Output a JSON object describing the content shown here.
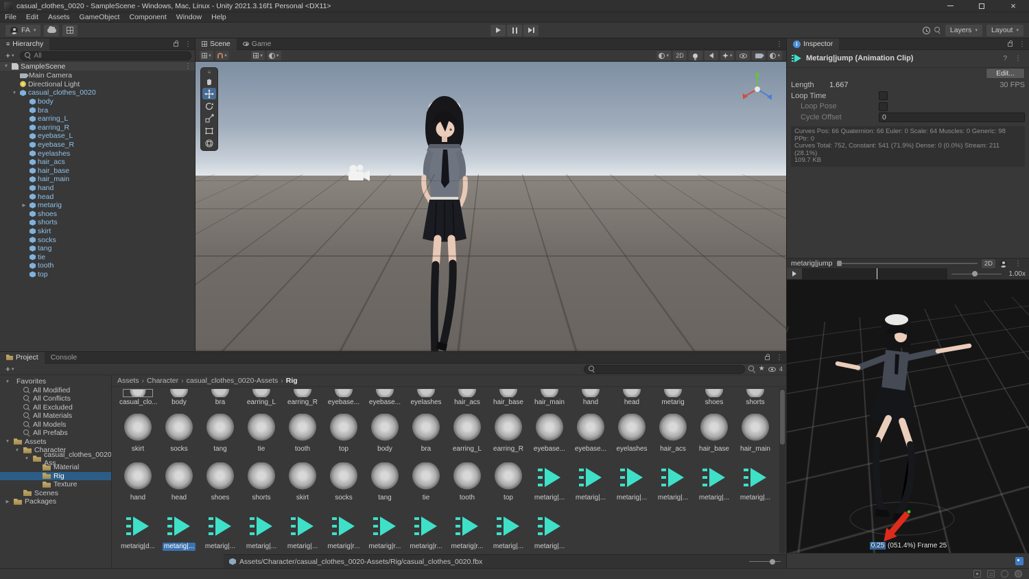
{
  "window": {
    "title": "casual_clothes_0020 - SampleScene - Windows, Mac, Linux - Unity 2021.3.16f1 Personal <DX11>"
  },
  "menu": [
    "File",
    "Edit",
    "Assets",
    "GameObject",
    "Component",
    "Window",
    "Help"
  ],
  "toolbar": {
    "account": "FA",
    "layers": "Layers",
    "layout": "Layout"
  },
  "hierarchy": {
    "tab": "Hierarchy",
    "search": "All",
    "scene_name": "SampleScene",
    "items": [
      {
        "label": "Main Camera",
        "d": 1,
        "icon": "camera"
      },
      {
        "label": "Directional Light",
        "d": 1,
        "icon": "light"
      },
      {
        "label": "casual_clothes_0020",
        "d": 1,
        "icon": "prefab",
        "kind": "prefab",
        "arrow": "▼"
      },
      {
        "label": "body",
        "d": 2,
        "icon": "prefab",
        "kind": "prefab"
      },
      {
        "label": "bra",
        "d": 2,
        "icon": "prefab",
        "kind": "prefab"
      },
      {
        "label": "earring_L",
        "d": 2,
        "icon": "prefab",
        "kind": "prefab"
      },
      {
        "label": "earring_R",
        "d": 2,
        "icon": "prefab",
        "kind": "prefab"
      },
      {
        "label": "eyebase_L",
        "d": 2,
        "icon": "prefab",
        "kind": "prefab"
      },
      {
        "label": "eyebase_R",
        "d": 2,
        "icon": "prefab",
        "kind": "prefab"
      },
      {
        "label": "eyelashes",
        "d": 2,
        "icon": "prefab",
        "kind": "prefab"
      },
      {
        "label": "hair_acs",
        "d": 2,
        "icon": "prefab",
        "kind": "prefab"
      },
      {
        "label": "hair_base",
        "d": 2,
        "icon": "prefab",
        "kind": "prefab"
      },
      {
        "label": "hair_main",
        "d": 2,
        "icon": "prefab",
        "kind": "prefab"
      },
      {
        "label": "hand",
        "d": 2,
        "icon": "prefab",
        "kind": "prefab"
      },
      {
        "label": "head",
        "d": 2,
        "icon": "prefab",
        "kind": "prefab"
      },
      {
        "label": "metarig",
        "d": 2,
        "icon": "prefab",
        "kind": "prefab",
        "arrow": "▶"
      },
      {
        "label": "shoes",
        "d": 2,
        "icon": "prefab",
        "kind": "prefab"
      },
      {
        "label": "shorts",
        "d": 2,
        "icon": "prefab",
        "kind": "prefab"
      },
      {
        "label": "skirt",
        "d": 2,
        "icon": "prefab",
        "kind": "prefab"
      },
      {
        "label": "socks",
        "d": 2,
        "icon": "prefab",
        "kind": "prefab"
      },
      {
        "label": "tang",
        "d": 2,
        "icon": "prefab",
        "kind": "prefab"
      },
      {
        "label": "tie",
        "d": 2,
        "icon": "prefab",
        "kind": "prefab"
      },
      {
        "label": "tooth",
        "d": 2,
        "icon": "prefab",
        "kind": "prefab"
      },
      {
        "label": "top",
        "d": 2,
        "icon": "prefab",
        "kind": "prefab"
      }
    ]
  },
  "scene": {
    "tab_scene": "Scene",
    "tab_game": "Game",
    "mode2d": "2D"
  },
  "inspector": {
    "tab": "Inspector",
    "title": "Metarig|jump (Animation Clip)",
    "edit": "Edit...",
    "length_label": "Length",
    "length_value": "1.667",
    "fps": "30 FPS",
    "loop_time": "Loop Time",
    "loop_pose": "Loop Pose",
    "cycle_offset": "Cycle Offset",
    "cycle_value": "0",
    "stats1": "Curves Pos: 66 Quaternion: 66 Euler: 0 Scale: 64 Muscles: 0 Generic: 98 PPtr: 0",
    "stats2": "Curves Total: 752, Constant: 541 (71.9%) Dense: 0 (0.0%) Stream: 211 (28.1%)",
    "stats3": "109.7 KB",
    "preview": {
      "clip": "metarig|jump",
      "mode2d": "2D",
      "speed": "1.00x",
      "frame_field": "0.25",
      "frame_info": "(051.4%) Frame 25"
    }
  },
  "project": {
    "tab": "Project",
    "console_tab": "Console",
    "hidden_count": "4",
    "breadcrumb": [
      "Assets",
      "Character",
      "casual_clothes_0020-Assets",
      "Rig"
    ],
    "tree": [
      {
        "label": "Favorites",
        "d": 0,
        "icon": "star",
        "arrow": "▼"
      },
      {
        "label": "All Modified",
        "d": 1,
        "icon": "search"
      },
      {
        "label": "All Conflicts",
        "d": 1,
        "icon": "search"
      },
      {
        "label": "All Excluded",
        "d": 1,
        "icon": "search"
      },
      {
        "label": "All Materials",
        "d": 1,
        "icon": "search"
      },
      {
        "label": "All Models",
        "d": 1,
        "icon": "search"
      },
      {
        "label": "All Prefabs",
        "d": 1,
        "icon": "search"
      },
      {
        "label": "Assets",
        "d": 0,
        "icon": "folder",
        "arrow": "▼"
      },
      {
        "label": "Character",
        "d": 1,
        "icon": "folder",
        "arrow": "▼"
      },
      {
        "label": "casual_clothes_0020-Ass...",
        "d": 2,
        "icon": "folder",
        "arrow": "▼"
      },
      {
        "label": "Material",
        "d": 3,
        "icon": "folder"
      },
      {
        "label": "Rig",
        "d": 3,
        "icon": "folder",
        "sel": true
      },
      {
        "label": "Texture",
        "d": 3,
        "icon": "folder"
      },
      {
        "label": "Scenes",
        "d": 1,
        "icon": "folder"
      },
      {
        "label": "Packages",
        "d": 0,
        "icon": "folder",
        "arrow": "▶"
      }
    ],
    "row1": [
      {
        "label": "casual_clo...",
        "thumb": "fbx",
        "outlined": true
      },
      {
        "label": "body",
        "thumb": "mesh"
      },
      {
        "label": "bra",
        "thumb": "mesh"
      },
      {
        "label": "earring_L",
        "thumb": "mesh"
      },
      {
        "label": "earring_R",
        "thumb": "mesh"
      },
      {
        "label": "eyebase...",
        "thumb": "mesh"
      },
      {
        "label": "eyebase...",
        "thumb": "mesh"
      },
      {
        "label": "eyelashes",
        "thumb": "mesh"
      },
      {
        "label": "hair_acs",
        "thumb": "mesh"
      },
      {
        "label": "hair_base",
        "thumb": "mesh"
      },
      {
        "label": "hair_main",
        "thumb": "mesh"
      },
      {
        "label": "hand",
        "thumb": "mesh"
      },
      {
        "label": "head",
        "thumb": "mesh"
      },
      {
        "label": "metarig",
        "thumb": "mesh"
      },
      {
        "label": "shoes",
        "thumb": "mesh"
      },
      {
        "label": "shorts",
        "thumb": "mesh"
      }
    ],
    "row2": [
      {
        "label": "skirt",
        "thumb": "mesh"
      },
      {
        "label": "socks",
        "thumb": "mesh"
      },
      {
        "label": "tang",
        "thumb": "mesh"
      },
      {
        "label": "tie",
        "thumb": "mesh"
      },
      {
        "label": "tooth",
        "thumb": "mesh"
      },
      {
        "label": "top",
        "thumb": "mesh"
      },
      {
        "label": "body",
        "thumb": "mesh"
      },
      {
        "label": "bra",
        "thumb": "mesh"
      },
      {
        "label": "earring_L",
        "thumb": "mesh"
      },
      {
        "label": "earring_R",
        "thumb": "mesh"
      },
      {
        "label": "eyebase...",
        "thumb": "mesh"
      },
      {
        "label": "eyebase...",
        "thumb": "mesh"
      },
      {
        "label": "eyelashes",
        "thumb": "mesh"
      },
      {
        "label": "hair_acs",
        "thumb": "mesh"
      },
      {
        "label": "hair_base",
        "thumb": "mesh"
      },
      {
        "label": "hair_main",
        "thumb": "mesh"
      }
    ],
    "row3": [
      {
        "label": "hand",
        "thumb": "mesh"
      },
      {
        "label": "head",
        "thumb": "mesh"
      },
      {
        "label": "shoes",
        "thumb": "mesh"
      },
      {
        "label": "shorts",
        "thumb": "mesh"
      },
      {
        "label": "skirt",
        "thumb": "mesh"
      },
      {
        "label": "socks",
        "thumb": "mesh"
      },
      {
        "label": "tang",
        "thumb": "mesh"
      },
      {
        "label": "tie",
        "thumb": "mesh"
      },
      {
        "label": "tooth",
        "thumb": "mesh"
      },
      {
        "label": "top",
        "thumb": "mesh"
      },
      {
        "label": "metarig|...",
        "thumb": "anim"
      },
      {
        "label": "metarig|...",
        "thumb": "anim"
      },
      {
        "label": "metarig|...",
        "thumb": "anim"
      },
      {
        "label": "metarig|...",
        "thumb": "anim"
      },
      {
        "label": "metarig|...",
        "thumb": "anim"
      },
      {
        "label": "metarig|...",
        "thumb": "anim"
      }
    ],
    "row4": [
      {
        "label": "metarig|d...",
        "thumb": "anim"
      },
      {
        "label": "metarig|...",
        "thumb": "anim",
        "sel": true
      },
      {
        "label": "metarig|...",
        "thumb": "anim"
      },
      {
        "label": "metarig|...",
        "thumb": "anim"
      },
      {
        "label": "metarig|...",
        "thumb": "anim"
      },
      {
        "label": "metarig|r...",
        "thumb": "anim"
      },
      {
        "label": "metarig|r...",
        "thumb": "anim"
      },
      {
        "label": "metarig|r...",
        "thumb": "anim"
      },
      {
        "label": "metarig|r...",
        "thumb": "anim"
      },
      {
        "label": "metarig|...",
        "thumb": "anim"
      },
      {
        "label": "metarig|...",
        "thumb": "anim"
      }
    ],
    "footer_path": "Assets/Character/casual_clothes_0020-Assets/Rig/casual_clothes_0020.fbx"
  }
}
